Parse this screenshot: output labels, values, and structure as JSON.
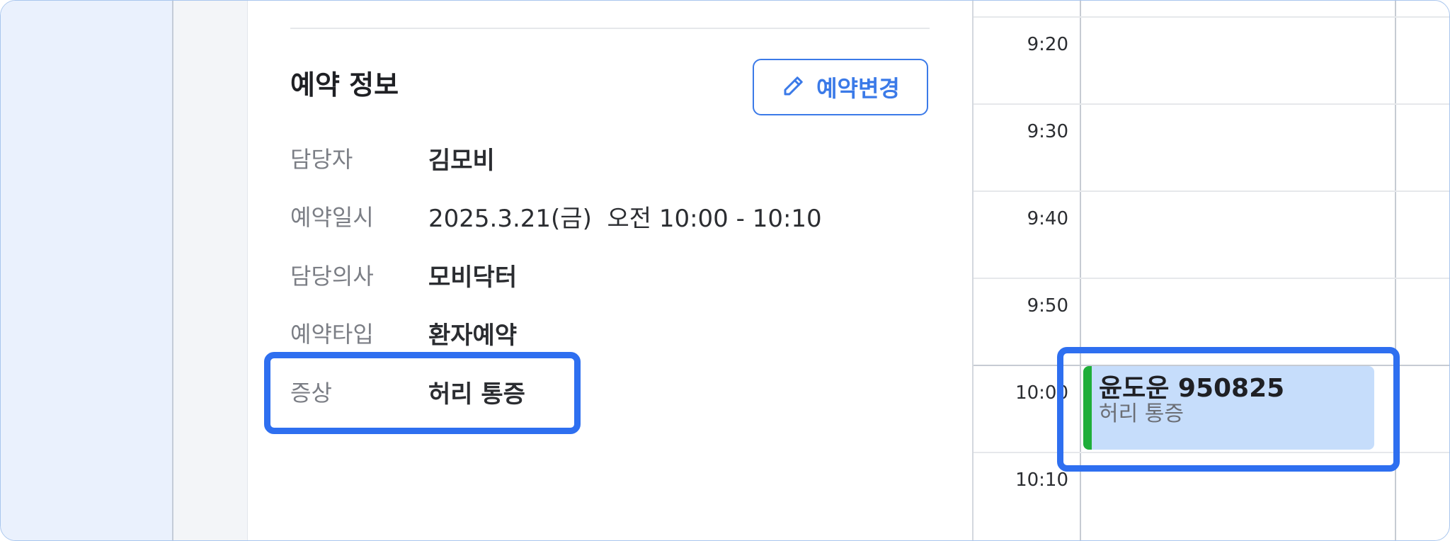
{
  "reservation": {
    "section_title": "예약 정보",
    "edit_button_label": "예약변경",
    "edit_icon": "pencil-icon",
    "rows": [
      {
        "label": "담당자",
        "value": "김모비"
      },
      {
        "label": "예약일시",
        "value": "2025.3.21(금)  오전 10:00 - 10:10"
      },
      {
        "label": "담당의사",
        "value": "모비닥터"
      },
      {
        "label": "예약타입",
        "value": "환자예약"
      },
      {
        "label": "증상",
        "value": "허리 통증"
      }
    ]
  },
  "calendar": {
    "time_labels": [
      "9:20",
      "9:30",
      "9:40",
      "9:50",
      "10:00",
      "10:10"
    ],
    "event": {
      "title": "윤도운 950825",
      "subtitle": "허리 통증",
      "accent_color": "#1fae3a",
      "background_color": "#c6ddfb"
    }
  },
  "colors": {
    "accent": "#3b7ae8",
    "highlight_outline": "#2e6ff0"
  }
}
